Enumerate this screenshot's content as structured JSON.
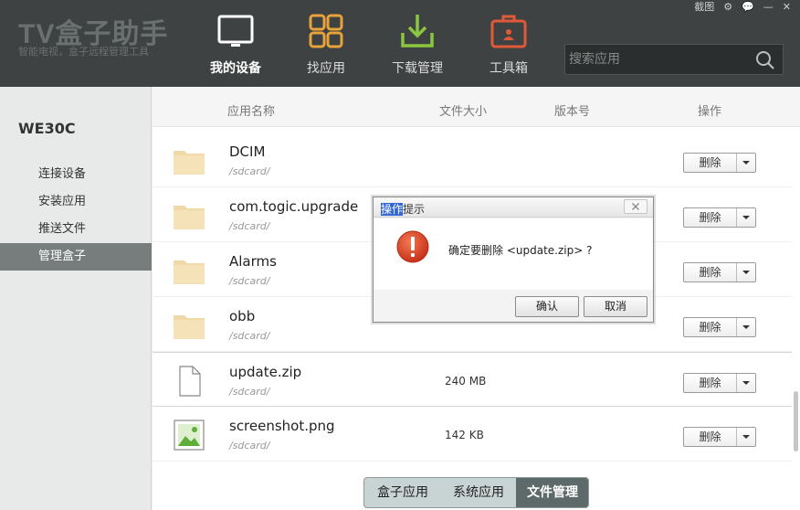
{
  "header": {
    "logo_title": "TV盒子助手",
    "logo_subtitle": "智能电视，盒子远程管理工具",
    "nav": [
      {
        "label": "我的设备",
        "icon": "monitor-icon",
        "active": true
      },
      {
        "label": "找应用",
        "icon": "grid-icon",
        "active": false
      },
      {
        "label": "下载管理",
        "icon": "download-icon",
        "active": false
      },
      {
        "label": "工具箱",
        "icon": "toolbox-icon",
        "active": false
      }
    ],
    "top_links": {
      "screenshot": "截图",
      "settings_icon": "gear-icon",
      "feedback_icon": "chat-icon",
      "minimize": "—",
      "close": "✕"
    },
    "search_placeholder": "搜索应用"
  },
  "sidebar": {
    "device_name": "WE30C",
    "items": [
      {
        "label": "连接设备",
        "active": false
      },
      {
        "label": "安装应用",
        "active": false
      },
      {
        "label": "推送文件",
        "active": false
      },
      {
        "label": "管理盒子",
        "active": true
      }
    ]
  },
  "table": {
    "columns": [
      "应用名称",
      "文件大小",
      "版本号",
      "操作"
    ],
    "rows": [
      {
        "name": "DCIM",
        "path": "/sdcard/",
        "size": "",
        "version": "",
        "icon": "folder-icon",
        "action": "删除"
      },
      {
        "name": "com.togic.upgrade",
        "path": "/sdcard/",
        "size": "",
        "version": "",
        "icon": "folder-icon",
        "action": "删除"
      },
      {
        "name": "Alarms",
        "path": "/sdcard/",
        "size": "",
        "version": "",
        "icon": "folder-icon",
        "action": "删除"
      },
      {
        "name": "obb",
        "path": "/sdcard/",
        "size": "",
        "version": "",
        "icon": "folder-icon",
        "action": "删除"
      },
      {
        "name": "update.zip",
        "path": "/sdcard/",
        "size": "240 MB",
        "version": "",
        "icon": "file-icon",
        "action": "删除"
      },
      {
        "name": "screenshot.png",
        "path": "/sdcard/",
        "size": "142 KB",
        "version": "",
        "icon": "image-icon",
        "action": "删除"
      }
    ]
  },
  "bottom_tabs": [
    {
      "label": "盒子应用",
      "active": false
    },
    {
      "label": "系统应用",
      "active": false
    },
    {
      "label": "文件管理",
      "active": true
    }
  ],
  "dialog": {
    "title_selected": "操作",
    "title_rest": "提示",
    "message": "确定要删除 <update.zip> ?",
    "confirm": "确认",
    "cancel": "取消"
  },
  "colors": {
    "header_bg": "#3e4242",
    "accent_orange": "#e8a33a",
    "accent_green": "#8cc63f",
    "accent_red": "#e05a3a",
    "sidebar_active": "#777c7c",
    "warning_red": "#d9432a"
  }
}
